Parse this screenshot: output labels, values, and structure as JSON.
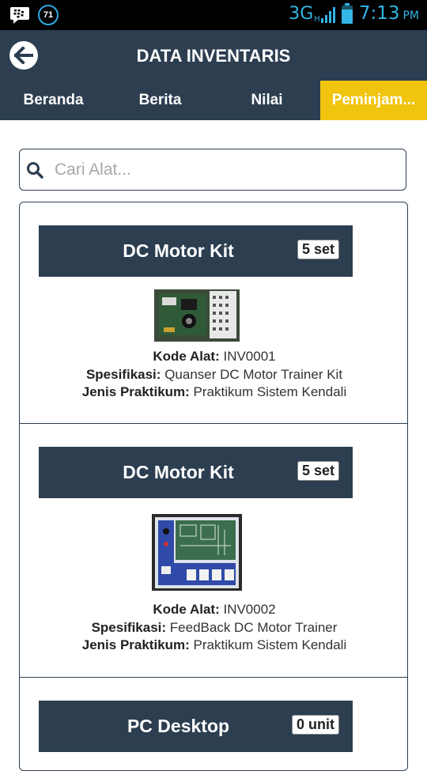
{
  "statusbar": {
    "notification_count": "71",
    "network": "3G",
    "network_sub": "H",
    "time": "7:13",
    "ampm": "PM"
  },
  "header": {
    "title": "DATA INVENTARIS"
  },
  "tabs": [
    {
      "label": "Beranda"
    },
    {
      "label": "Berita"
    },
    {
      "label": "Nilai"
    },
    {
      "label": "Peminjam..."
    }
  ],
  "search": {
    "placeholder": "Cari Alat..."
  },
  "labels": {
    "kode": "Kode Alat:",
    "spesifikasi": "Spesifikasi:",
    "jenis": "Jenis Praktikum:"
  },
  "items": [
    {
      "name": "DC Motor Kit",
      "qty": "5 set",
      "kode": "INV0001",
      "spesifikasi": "Quanser DC Motor Trainer Kit",
      "jenis": "Praktikum Sistem Kendali"
    },
    {
      "name": "DC Motor Kit",
      "qty": "5 set",
      "kode": "INV0002",
      "spesifikasi": "FeedBack DC Motor Trainer",
      "jenis": "Praktikum Sistem Kendali"
    },
    {
      "name": "PC Desktop",
      "qty": "0 unit"
    }
  ],
  "colors": {
    "primary": "#2c3e50",
    "accent": "#f1c40f",
    "status_icon": "#33b5e5"
  },
  "icons": {
    "back": "arrow-left-icon",
    "search": "search-icon",
    "bbm": "bbm-icon"
  }
}
